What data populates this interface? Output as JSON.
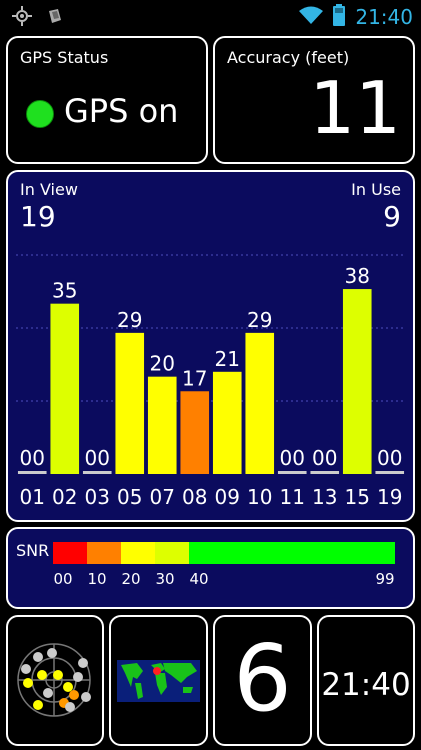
{
  "status_bar": {
    "time": "21:40",
    "left_icons": [
      "gps-crosshair-icon",
      "notification-icon"
    ],
    "right_icons": [
      "wifi-icon",
      "battery-icon"
    ]
  },
  "gps_status": {
    "label": "GPS Status",
    "value": "GPS on",
    "indicator_color": "#1fe01f"
  },
  "accuracy": {
    "label": "Accuracy (feet)",
    "value": "11"
  },
  "satellites": {
    "in_view_label": "In View",
    "in_view_value": "19",
    "in_use_label": "In Use",
    "in_use_value": "9"
  },
  "chart_data": {
    "type": "bar",
    "categories": [
      "01",
      "02",
      "03",
      "05",
      "07",
      "08",
      "09",
      "10",
      "11",
      "13",
      "15",
      "19"
    ],
    "values": [
      0,
      35,
      0,
      29,
      20,
      17,
      21,
      29,
      0,
      0,
      38,
      0
    ],
    "value_labels": [
      "00",
      "35",
      "00",
      "29",
      "20",
      "17",
      "21",
      "29",
      "00",
      "00",
      "38",
      "00"
    ],
    "ylim": [
      0,
      60
    ],
    "grid": true
  },
  "snr": {
    "label": "SNR",
    "ticks": [
      "00",
      "10",
      "20",
      "30",
      "40",
      "99"
    ],
    "segment_colors": [
      "#ff0000",
      "#ff8000",
      "#ffff00",
      "#ddff00",
      "#00ff00"
    ]
  },
  "bottom": {
    "satellite_count": "6",
    "clock": "21:40",
    "icons": [
      "sky-radar-icon",
      "world-map-icon"
    ]
  }
}
